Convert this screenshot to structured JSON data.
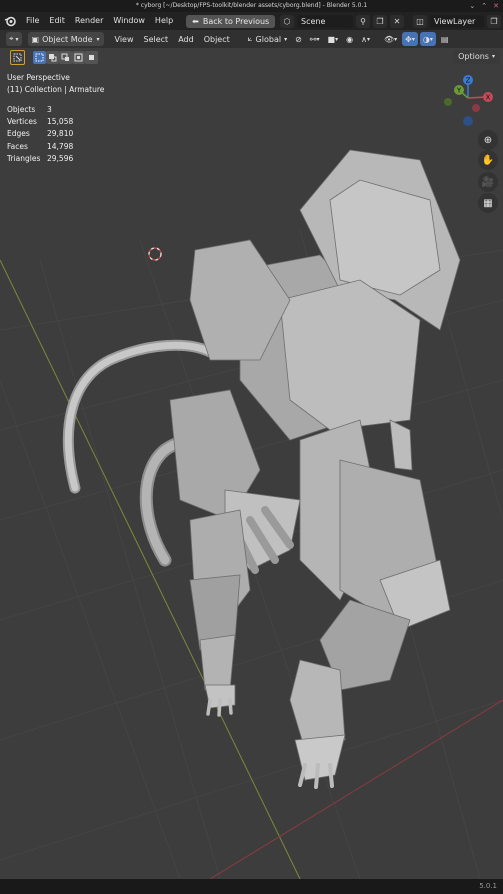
{
  "window": {
    "title": "* cyborg [~/Desktop/FPS-toolkit/blender assets/cyborg.blend] - Blender 5.0.1"
  },
  "menubar": {
    "items": [
      "File",
      "Edit",
      "Render",
      "Window",
      "Help"
    ],
    "back_button": "Back to Previous",
    "scene_name": "Scene",
    "view_layer": "ViewLayer"
  },
  "header": {
    "mode": "Object Mode",
    "menus": [
      "View",
      "Select",
      "Add",
      "Object"
    ],
    "orientation": "Global"
  },
  "toolbar": {
    "options_label": "Options"
  },
  "viewport_info": {
    "perspective": "User Perspective",
    "collection": "(11) Collection | Armature"
  },
  "stats": [
    {
      "label": "Objects",
      "value": "3"
    },
    {
      "label": "Vertices",
      "value": "15,058"
    },
    {
      "label": "Edges",
      "value": "29,810"
    },
    {
      "label": "Faces",
      "value": "14,798"
    },
    {
      "label": "Triangles",
      "value": "29,596"
    }
  ],
  "gizmo": {
    "x": "X",
    "y": "Y",
    "z": "Z"
  },
  "statusbar": {
    "version": "5.0.1"
  },
  "colors": {
    "axis_x": "#c64b5a",
    "axis_y": "#6a9a3a",
    "axis_z": "#3b7bd6",
    "accent": "#4772b3"
  }
}
